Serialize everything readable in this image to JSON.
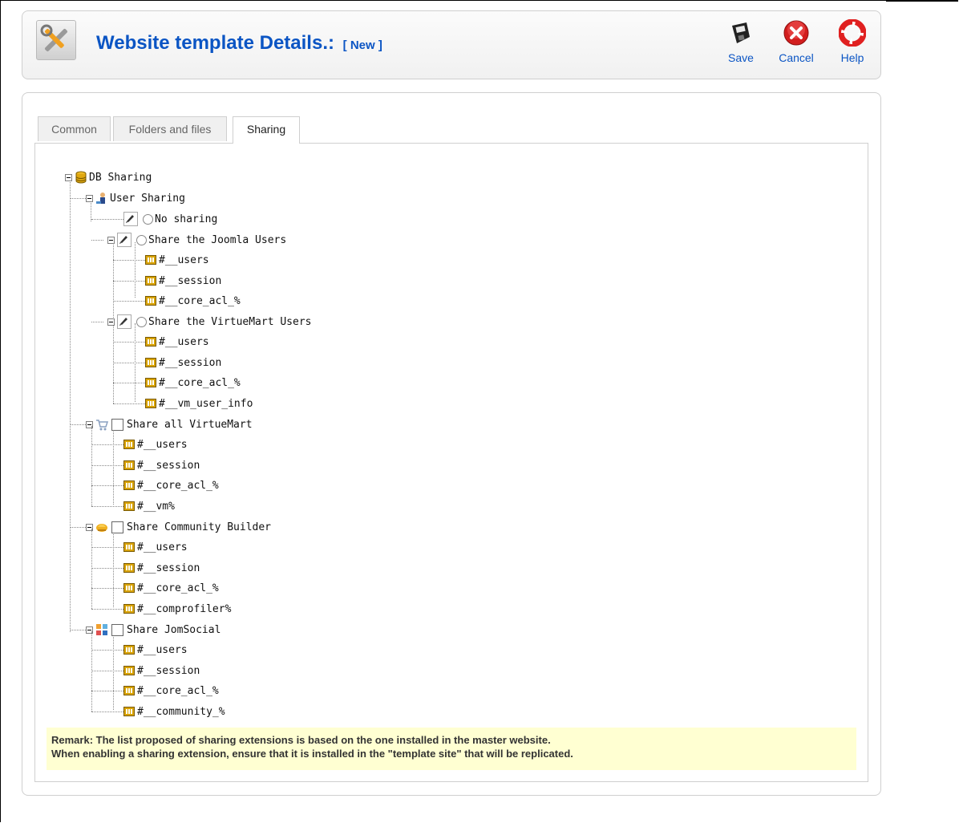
{
  "header": {
    "title": "Website template Details.:",
    "status": "[ New ]",
    "toolbar": {
      "save_label": "Save",
      "cancel_label": "Cancel",
      "help_label": "Help"
    }
  },
  "tabs": [
    "Common",
    "Folders and files",
    "Sharing"
  ],
  "tree": {
    "root": "DB Sharing",
    "user_sharing": "User Sharing",
    "no_sharing": "No sharing",
    "share_joomla": "Share the Joomla Users",
    "joomla_tables": [
      "#__users",
      "#__session",
      "#__core_acl_%"
    ],
    "share_vm_users": "Share the VirtueMart Users",
    "vm_users_tables": [
      "#__users",
      "#__session",
      "#__core_acl_%",
      "#__vm_user_info"
    ],
    "share_all_vm": "Share all VirtueMart",
    "all_vm_tables": [
      "#__users",
      "#__session",
      "#__core_acl_%",
      "#__vm%"
    ],
    "share_cb": "Share Community Builder",
    "cb_tables": [
      "#__users",
      "#__session",
      "#__core_acl_%",
      "#__comprofiler%"
    ],
    "share_jomsocial": "Share JomSocial",
    "jomsocial_tables": [
      "#__users",
      "#__session",
      "#__core_acl_%",
      "#__community_%"
    ]
  },
  "remark": {
    "line1": "Remark: The list proposed of sharing extensions is based on the one installed in the master website.",
    "line2": "When enabling a sharing extension, ensure that it is installed in the \"template site\" that will be replicated."
  },
  "colors": {
    "title": "#0b55c4",
    "remark_bg": "#ffffd2",
    "table_icon": "#d9a300"
  }
}
